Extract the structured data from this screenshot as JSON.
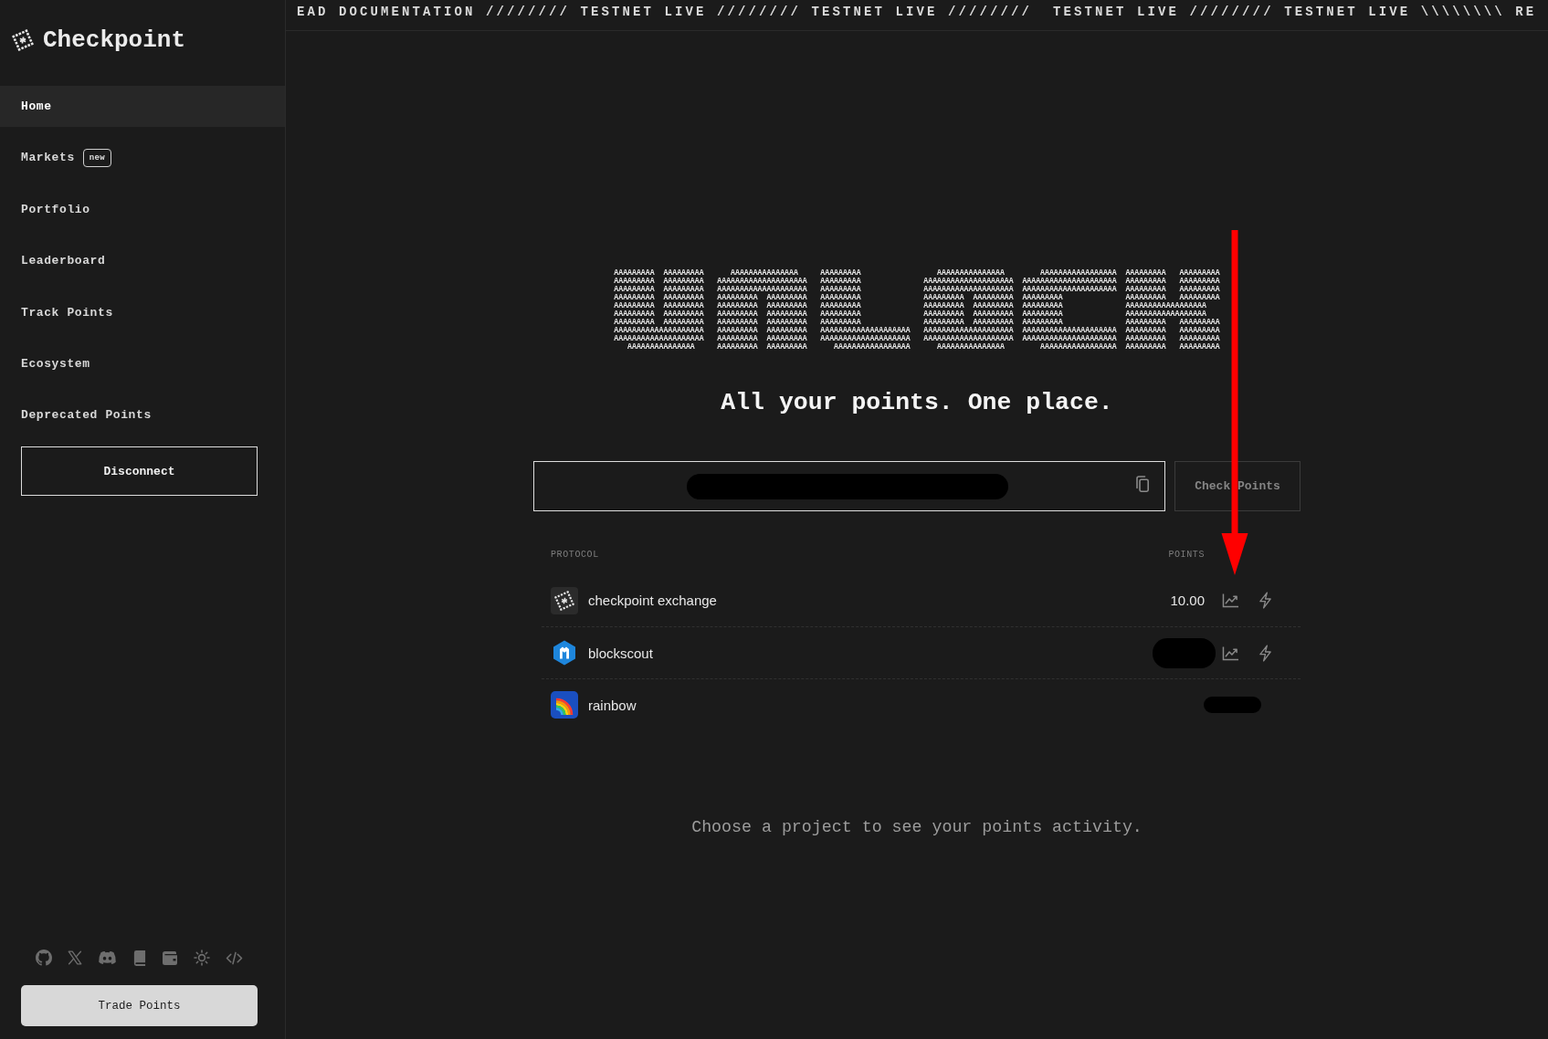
{
  "sidebar": {
    "logo": "Checkpoint",
    "nav": [
      {
        "label": "Home",
        "selected": true
      },
      {
        "label": "Markets",
        "selected": false,
        "badge": "new"
      },
      {
        "label": "Portfolio",
        "selected": false
      },
      {
        "label": "Leaderboard",
        "selected": false
      },
      {
        "label": "Track Points",
        "selected": false
      },
      {
        "label": "Ecosystem",
        "selected": false
      },
      {
        "label": "Deprecated Points",
        "selected": false
      }
    ],
    "disconnect_button": "Disconnect",
    "trade_button": "Trade Points"
  },
  "ticker": "EAD DOCUMENTATION //////// TESTNET LIVE //////// TESTNET LIVE ////////  TESTNET LIVE //////// TESTNET LIVE \\\\\\\\\\\\\\\\ RE",
  "hero": {
    "art_lines": [
      "AAAAAAAAA  AAAAAAAAA      AAAAAAAAAAAAAAA     AAAAAAAAA                 AAAAAAAAAAAAAAA        AAAAAAAAAAAAAAAAA  AAAAAAAAA   AAAAAAAAA",
      "AAAAAAAAA  AAAAAAAAA   AAAAAAAAAAAAAAAAAAAA   AAAAAAAAA              AAAAAAAAAAAAAAAAAAAA  AAAAAAAAAAAAAAAAAAAAA  AAAAAAAAA   AAAAAAAAA",
      "AAAAAAAAA  AAAAAAAAA   AAAAAAAAAAAAAAAAAAAA   AAAAAAAAA              AAAAAAAAAAAAAAAAAAAA  AAAAAAAAAAAAAAAAAAAAA  AAAAAAAAA   AAAAAAAAA",
      "AAAAAAAAA  AAAAAAAAA   AAAAAAAAA  AAAAAAAAA   AAAAAAAAA              AAAAAAAAA  AAAAAAAAA  AAAAAAAAA              AAAAAAAAA   AAAAAAAAA",
      "AAAAAAAAA  AAAAAAAAA   AAAAAAAAA  AAAAAAAAA   AAAAAAAAA              AAAAAAAAA  AAAAAAAAA  AAAAAAAAA              AAAAAAAAAAAAAAAAAA",
      "AAAAAAAAA  AAAAAAAAA   AAAAAAAAA  AAAAAAAAA   AAAAAAAAA              AAAAAAAAA  AAAAAAAAA  AAAAAAAAA              AAAAAAAAAAAAAAAAAA",
      "AAAAAAAAA  AAAAAAAAA   AAAAAAAAA  AAAAAAAAA   AAAAAAAAA              AAAAAAAAA  AAAAAAAAA  AAAAAAAAA              AAAAAAAAA   AAAAAAAAA",
      "AAAAAAAAAAAAAAAAAAAA   AAAAAAAAA  AAAAAAAAA   AAAAAAAAAAAAAAAAAAAA   AAAAAAAAAAAAAAAAAAAA  AAAAAAAAAAAAAAAAAAAAA  AAAAAAAAA   AAAAAAAAA",
      "AAAAAAAAAAAAAAAAAAAA   AAAAAAAAA  AAAAAAAAA   AAAAAAAAAAAAAAAAAAAA   AAAAAAAAAAAAAAAAAAAA  AAAAAAAAAAAAAAAAAAAAA  AAAAAAAAA   AAAAAAAAA",
      "   AAAAAAAAAAAAAAA     AAAAAAAAA  AAAAAAAAA      AAAAAAAAAAAAAAAAA      AAAAAAAAAAAAAAA        AAAAAAAAAAAAAAAAA  AAAAAAAAA   AAAAAAAAA"
    ],
    "tagline": "All your points. One place."
  },
  "address_lookup": {
    "redacted": true,
    "button": {
      "label": "Check Points",
      "disabled": true
    }
  },
  "points_table": {
    "columns": [
      "PROTOCOL",
      "POINTS"
    ],
    "rows": [
      {
        "protocol": "checkpoint exchange",
        "points": "10.00",
        "redacted": false,
        "actions": true
      },
      {
        "protocol": "blockscout",
        "redacted": true,
        "actions": true
      },
      {
        "protocol": "rainbow",
        "redacted": true,
        "actions": false
      }
    ]
  },
  "empty_state": "Choose a project to see your points activity."
}
